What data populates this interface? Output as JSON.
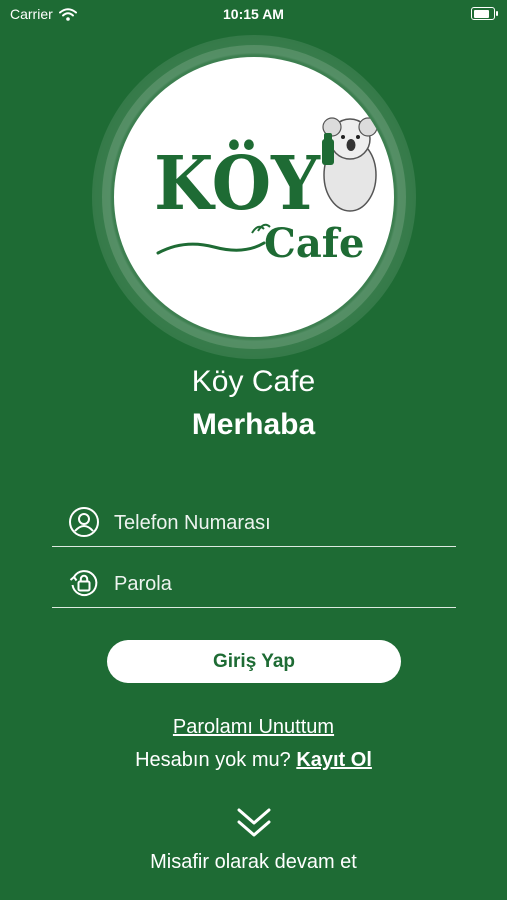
{
  "status_bar": {
    "carrier": "Carrier",
    "time": "10:15 AM",
    "battery_level": 0.95
  },
  "logo": {
    "brand_top": "KÖY",
    "brand_bottom": "Cafe",
    "mascot": "koala-icon"
  },
  "header": {
    "app_name": "Köy Cafe",
    "greeting": "Merhaba"
  },
  "form": {
    "phone_placeholder": "Telefon Numarası",
    "phone_icon": "user-icon",
    "password_placeholder": "Parola",
    "password_icon": "lock-icon",
    "login_label": "Giriş Yap"
  },
  "links": {
    "forgot_password": "Parolamı Unuttum",
    "no_account": "Hesabın yok mu?",
    "register": "Kayıt Ol"
  },
  "guest": {
    "icon": "chevron-double-down-icon",
    "label": "Misafir olarak devam et"
  },
  "colors": {
    "background": "#1e6b34",
    "accent": "#1e6b34",
    "text": "#ffffff"
  }
}
